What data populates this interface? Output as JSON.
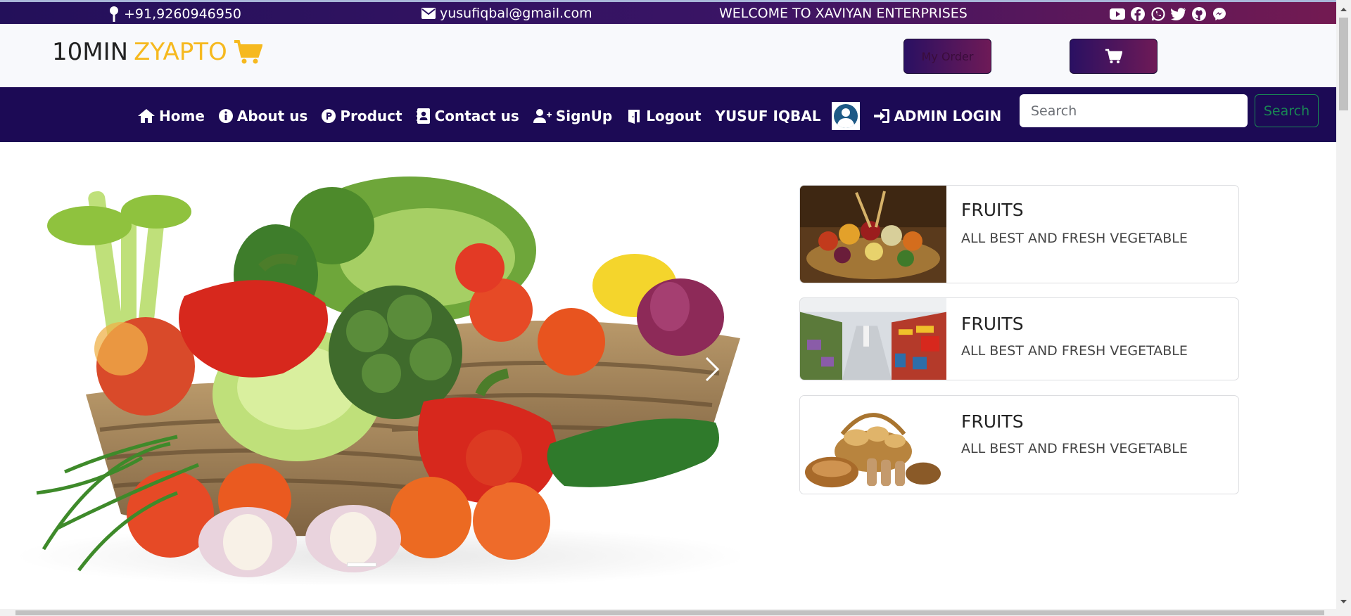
{
  "topbar": {
    "phone": "+91,9260946950",
    "email": "yusufiqbal@gmail.com",
    "welcome": "WELCOME TO XAVIYAN ENTERPRISES",
    "social_icons": [
      "youtube-icon",
      "facebook-icon",
      "whatsapp-icon",
      "twitter-icon",
      "github-icon",
      "messenger-icon"
    ]
  },
  "header": {
    "brand_prefix": "10MIN",
    "brand_accent": "ZYAPTO",
    "order_button": "My Order",
    "accent_color": "#f6b91f"
  },
  "nav": {
    "items": [
      {
        "label": "Home",
        "icon": "home-icon"
      },
      {
        "label": "About us",
        "icon": "info-icon"
      },
      {
        "label": "Product",
        "icon": "product-icon"
      },
      {
        "label": "Contact us",
        "icon": "contact-icon"
      },
      {
        "label": "SignUp",
        "icon": "user-plus-icon"
      },
      {
        "label": "Logout",
        "icon": "logout-icon"
      }
    ],
    "user_name": "YUSUF IQBAL",
    "admin_login": "ADMIN LOGIN"
  },
  "search": {
    "placeholder": "Search",
    "button": "Search"
  },
  "cards": [
    {
      "title": "FRUITS",
      "text": "ALL BEST AND FRESH VEGETABLE",
      "image": "fruit-basket-image"
    },
    {
      "title": "FRUITS",
      "text": "ALL BEST AND FRESH VEGETABLE",
      "image": "supermarket-image"
    },
    {
      "title": "FRUITS",
      "text": "ALL BEST AND FRESH VEGETABLE",
      "image": "bread-basket-image"
    }
  ]
}
